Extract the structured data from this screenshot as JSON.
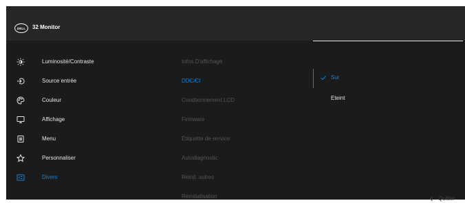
{
  "header": {
    "logo_text": "DELL",
    "title": "32 Monitor"
  },
  "menu": {
    "items": [
      {
        "label": "Luminosité/Contraste",
        "icon": "brightness-icon"
      },
      {
        "label": "Source entrée",
        "icon": "input-source-icon"
      },
      {
        "label": "Couleur",
        "icon": "color-palette-icon"
      },
      {
        "label": "Affichage",
        "icon": "display-icon"
      },
      {
        "label": "Menu",
        "icon": "menu-icon"
      },
      {
        "label": "Personnaliser",
        "icon": "star-icon"
      },
      {
        "label": "Divers",
        "icon": "others-icon",
        "active": true
      }
    ]
  },
  "submenu": {
    "items": [
      {
        "label": "Infos D'affichage"
      },
      {
        "label": "DDC/CI",
        "active": true
      },
      {
        "label": "Condtionnement LCD"
      },
      {
        "label": "Firmware"
      },
      {
        "label": "Étiquette de service"
      },
      {
        "label": "Autodiagnostic"
      },
      {
        "label": "Réinit. autres"
      },
      {
        "label": "Réinitialisation"
      }
    ]
  },
  "values": {
    "items": [
      {
        "label": "Sur",
        "selected": true
      },
      {
        "label": "Eteint"
      }
    ]
  },
  "footer": {
    "exit_label": "Quitter",
    "exit_icon": "chevron-left-icon"
  },
  "colors": {
    "accent": "#1483d8",
    "background": "#1b1b1b",
    "header": "#262626",
    "text": "#e6e6e6",
    "dimmed_text": "#555555"
  }
}
